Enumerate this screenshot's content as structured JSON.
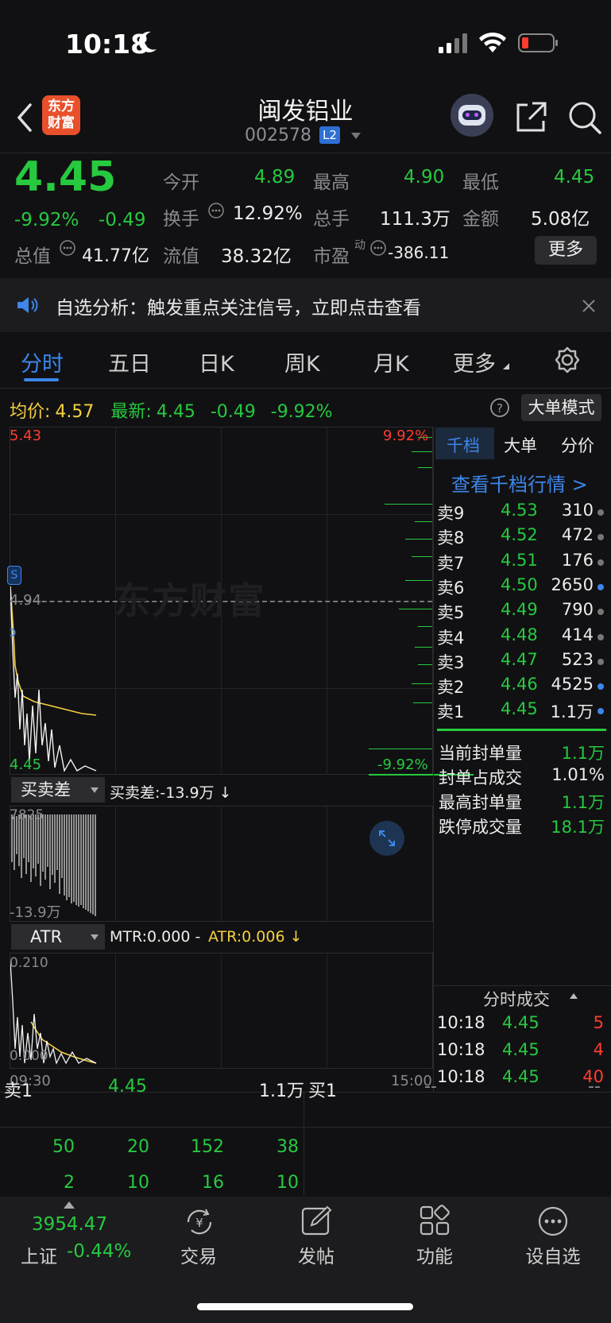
{
  "status": {
    "time": "10:18"
  },
  "header": {
    "logo_line1": "东方",
    "logo_line2": "财富",
    "title": "闽发铝业",
    "code": "002578",
    "level": "L2"
  },
  "quote": {
    "price": "4.45",
    "pct": "-9.92%",
    "chg": "-0.49",
    "open_label": "今开",
    "open": "4.89",
    "high_label": "最高",
    "high": "4.90",
    "low_label": "最低",
    "low": "4.45",
    "turnover_label": "换手",
    "turnover": "12.92%",
    "volume_label": "总手",
    "volume": "111.3万",
    "amount_label": "金额",
    "amount": "5.08亿",
    "mcap_label": "总值",
    "mcap": "41.77亿",
    "float_label": "流值",
    "float": "38.32亿",
    "pe_label": "市盈",
    "pe_sup": "动",
    "pe": "-386.11",
    "more_btn": "更多"
  },
  "notice": {
    "text": "自选分析：触发重点关注信号，立即点击查看"
  },
  "tabs": [
    "分时",
    "五日",
    "日K",
    "周K",
    "月K",
    "更多"
  ],
  "infoline": {
    "avg_label": "均价:",
    "avg": "4.57",
    "last_label": "最新:",
    "last": "4.45",
    "chg": "-0.49",
    "pct": "-9.92%",
    "mode_btn": "大单模式"
  },
  "chart": {
    "top_price": "5.43",
    "top_pct": "9.92%",
    "mid_price": "4.94",
    "bot_price": "4.45",
    "bot_pct": "-9.92%",
    "watermark": "东方财富",
    "start_time": "09:30",
    "end_time": "15:00"
  },
  "indicator1": {
    "name": "买卖差",
    "value": "买卖差:-13.9万 ↓",
    "top": "7825",
    "bottom": "-13.9万"
  },
  "indicator2": {
    "name": "ATR",
    "mtr": "MTR:0.000 -",
    "atr": "ATR:0.006 ↓",
    "top": "0.210",
    "bottom": "0.000"
  },
  "orderbook": {
    "tabs": [
      "千档",
      "大单",
      "分价"
    ],
    "link": "查看千档行情 >",
    "asks": [
      {
        "label": "卖9",
        "price": "4.53",
        "vol": "310",
        "dot": "#777777"
      },
      {
        "label": "卖8",
        "price": "4.52",
        "vol": "472",
        "dot": "#777777"
      },
      {
        "label": "卖7",
        "price": "4.51",
        "vol": "176",
        "dot": "#777777"
      },
      {
        "label": "卖6",
        "price": "4.50",
        "vol": "2650",
        "dot": "#3d86ea"
      },
      {
        "label": "卖5",
        "price": "4.49",
        "vol": "790",
        "dot": "#777777"
      },
      {
        "label": "卖4",
        "price": "4.48",
        "vol": "414",
        "dot": "#777777"
      },
      {
        "label": "卖3",
        "price": "4.47",
        "vol": "523",
        "dot": "#777777"
      },
      {
        "label": "卖2",
        "price": "4.46",
        "vol": "4525",
        "dot": "#3d86ea"
      },
      {
        "label": "卖1",
        "price": "4.45",
        "vol": "1.1万",
        "dot": "#3d86ea"
      }
    ],
    "stats": [
      {
        "label": "当前封单量",
        "value": "1.1万",
        "color": "#27c93f"
      },
      {
        "label": "封单占成交",
        "value": "1.01%",
        "color": "#ececec"
      },
      {
        "label": "最高封单量",
        "value": "1.1万",
        "color": "#27c93f"
      },
      {
        "label": "跌停成交量",
        "value": "18.1万",
        "color": "#27c93f"
      }
    ],
    "ticks_title": "分时成交",
    "ticks": [
      {
        "time": "10:18",
        "price": "4.45",
        "vol": "5"
      },
      {
        "time": "10:18",
        "price": "4.45",
        "vol": "4"
      },
      {
        "time": "10:18",
        "price": "4.45",
        "vol": "40"
      }
    ]
  },
  "bottom": {
    "sell_label": "卖1",
    "sell_price": "4.45",
    "sell_vol": "1.1万",
    "buy_label": "买1",
    "buy_price": "--",
    "buy_vol": "--",
    "row1": [
      "50",
      "20",
      "152",
      "38"
    ],
    "row2": [
      "2",
      "10",
      "16",
      "10"
    ]
  },
  "nav": {
    "index_value": "3954.47",
    "index_name": "上证",
    "index_pct": "-0.44%",
    "items": [
      "交易",
      "发帖",
      "功能",
      "设自选"
    ]
  },
  "colors": {
    "up": "#ff3b30",
    "down": "#27c93f",
    "accent": "#3d86ea",
    "avg": "#f4d03f"
  }
}
